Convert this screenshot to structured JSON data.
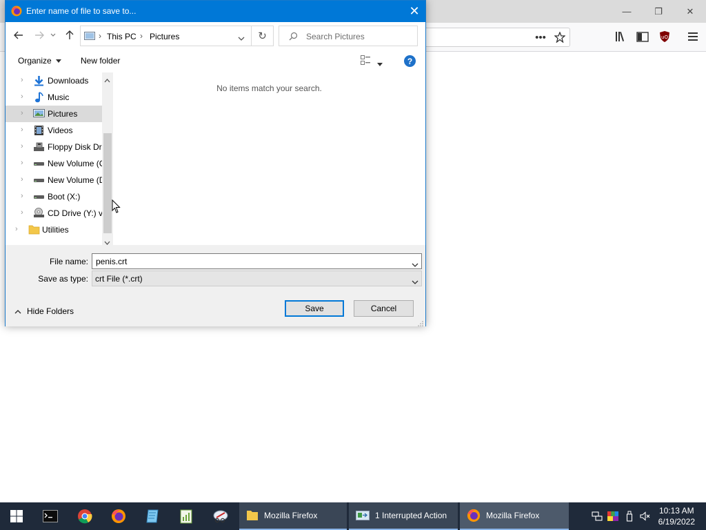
{
  "dialog": {
    "title": "Enter name of file to save to...",
    "close_glyph": "✕",
    "breadcrumb": [
      "This PC",
      "Pictures"
    ],
    "search_placeholder": "Search Pictures",
    "organize_label": "Organize",
    "new_folder_label": "New folder",
    "empty_message": "No items match your search.",
    "tree": [
      {
        "label": "Downloads",
        "icon": "downloads-icon",
        "selected": false
      },
      {
        "label": "Music",
        "icon": "music-icon",
        "selected": false
      },
      {
        "label": "Pictures",
        "icon": "pictures-icon",
        "selected": true
      },
      {
        "label": "Videos",
        "icon": "videos-icon",
        "selected": false
      },
      {
        "label": "Floppy Disk Dri",
        "icon": "floppy-drive-icon",
        "selected": false
      },
      {
        "label": "New Volume (C",
        "icon": "drive-icon",
        "selected": false
      },
      {
        "label": "New Volume (D",
        "icon": "drive-icon",
        "selected": false
      },
      {
        "label": "Boot (X:)",
        "icon": "drive-icon",
        "selected": false
      },
      {
        "label": "CD Drive (Y:) vi",
        "icon": "cd-drive-icon",
        "selected": false
      },
      {
        "label": "Utilities",
        "icon": "folder-icon",
        "selected": false
      }
    ],
    "file_name_label": "File name:",
    "file_name_value": "penis.crt",
    "save_type_label": "Save as type:",
    "save_type_value": "crt File (*.crt)",
    "hide_folders_label": "Hide Folders",
    "save_label": "Save",
    "cancel_label": "Cancel",
    "accent": "#0078d7"
  },
  "taskbar": {
    "tasks": [
      {
        "label": "Mozilla Firefox",
        "icon": "folder-icon"
      },
      {
        "label": "1 Interrupted Action",
        "icon": "file-copy-icon"
      },
      {
        "label": "Mozilla Firefox",
        "icon": "firefox-icon"
      }
    ],
    "time": "10:13 AM",
    "date": "6/19/2022"
  },
  "browser": {
    "minimize_glyph": "—",
    "restore_glyph": "❐",
    "close_glyph": "✕"
  }
}
